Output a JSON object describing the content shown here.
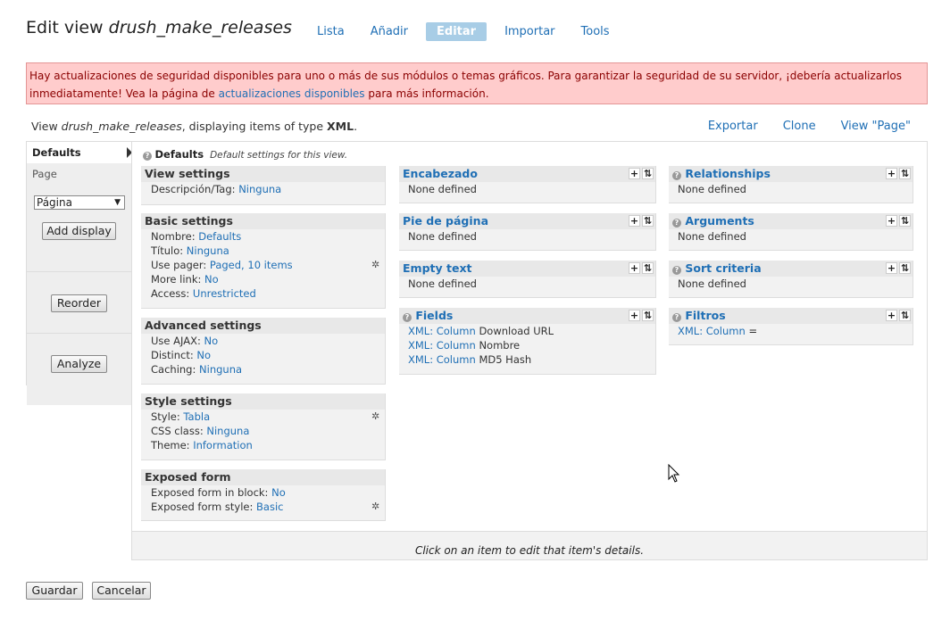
{
  "header": {
    "title_prefix": "Edit view",
    "title_name": "drush_make_releases",
    "tabs": [
      {
        "label": "Lista"
      },
      {
        "label": "Añadir"
      },
      {
        "label": "Editar",
        "active": true
      },
      {
        "label": "Importar"
      },
      {
        "label": "Tools"
      }
    ]
  },
  "alert": {
    "text_before": "Hay actualizaciones de seguridad disponibles para uno o más de sus módulos o temas gráficos. Para garantizar la seguridad de su servidor, ¡debería actualizarlos inmediatamente! Vea la página de ",
    "link": "actualizaciones disponibles",
    "text_after": " para más información.",
    "bg_color": "#ffcccc",
    "text_color": "#8b0000"
  },
  "viewbar": {
    "prefix": "View",
    "name": "drush_make_releases",
    "middle": ", displaying items of type",
    "type": "XML",
    "suffix": ".",
    "links": [
      "Exportar",
      "Clone",
      "View \"Page\""
    ]
  },
  "sidebar": {
    "defaults_label": "Defaults",
    "page_label": "Page",
    "select_value": "Página",
    "add_display": "Add display",
    "reorder": "Reorder",
    "analyze": "Analyze"
  },
  "main": {
    "head_title": "Defaults",
    "head_desc": "Default settings for this view.",
    "view_settings": {
      "title": "View settings",
      "rows": [
        {
          "label": "Descripción/Tag:",
          "value": "Ninguna"
        }
      ]
    },
    "basic_settings": {
      "title": "Basic settings",
      "rows": [
        {
          "label": "Nombre:",
          "value": "Defaults"
        },
        {
          "label": "Título:",
          "value": "Ninguna"
        },
        {
          "label": "Use pager:",
          "value": "Paged, 10 items"
        },
        {
          "label": "More link:",
          "value": "No"
        },
        {
          "label": "Access:",
          "value": "Unrestricted"
        }
      ]
    },
    "advanced_settings": {
      "title": "Advanced settings",
      "rows": [
        {
          "label": "Use AJAX:",
          "value": "No"
        },
        {
          "label": "Distinct:",
          "value": "No"
        },
        {
          "label": "Caching:",
          "value": "Ninguna"
        }
      ]
    },
    "style_settings": {
      "title": "Style settings",
      "rows": [
        {
          "label": "Style:",
          "value": "Tabla"
        },
        {
          "label": "CSS class:",
          "value": "Ninguna"
        },
        {
          "label": "Theme:",
          "value": "Information"
        }
      ]
    },
    "exposed_form": {
      "title": "Exposed form",
      "rows": [
        {
          "label": "Exposed form in block:",
          "value": "No"
        },
        {
          "label": "Exposed form style:",
          "value": "Basic"
        }
      ]
    },
    "encabezado": {
      "title": "Encabezado",
      "empty": "None defined"
    },
    "pie": {
      "title": "Pie de página",
      "empty": "None defined"
    },
    "empty_text": {
      "title": "Empty text",
      "empty": "None defined"
    },
    "fields": {
      "title": "Fields",
      "rows": [
        {
          "link": "XML: Column",
          "text": "Download URL"
        },
        {
          "link": "XML: Column",
          "text": "Nombre"
        },
        {
          "link": "XML: Column",
          "text": "MD5 Hash"
        }
      ]
    },
    "relationships": {
      "title": "Relationships",
      "empty": "None defined"
    },
    "arguments": {
      "title": "Arguments",
      "empty": "None defined"
    },
    "sort_criteria": {
      "title": "Sort criteria",
      "empty": "None defined"
    },
    "filtros": {
      "title": "Filtros",
      "rows": [
        {
          "link": "XML: Column",
          "text": "="
        }
      ]
    },
    "footer_text": "Click on an item to edit that item's details."
  },
  "buttons": {
    "save": "Guardar",
    "cancel": "Cancelar"
  },
  "icons": {
    "add": "plus-icon",
    "rearrange": "rearrange-icon",
    "settings": "gear-icon",
    "help": "help-icon"
  }
}
